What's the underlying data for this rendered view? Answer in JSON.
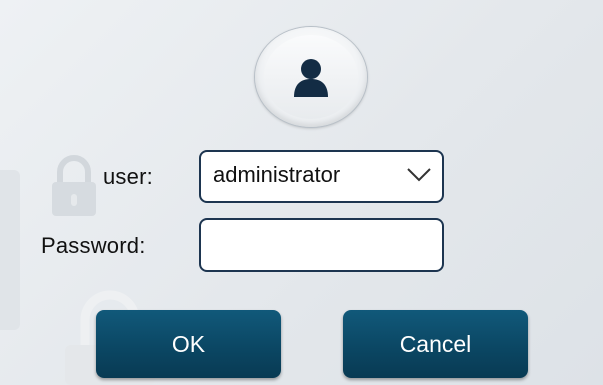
{
  "login": {
    "user_label": "user:",
    "user_value": "administrator",
    "password_label": "Password:",
    "password_value": "",
    "ok_label": "OK",
    "cancel_label": "Cancel"
  },
  "icons": {
    "avatar": "user-icon",
    "dropdown": "chevron-down-icon",
    "background": "padlock-icon"
  },
  "colors": {
    "button": "#0b4764",
    "field_border": "#1d3550",
    "avatar_icon": "#132c44"
  }
}
